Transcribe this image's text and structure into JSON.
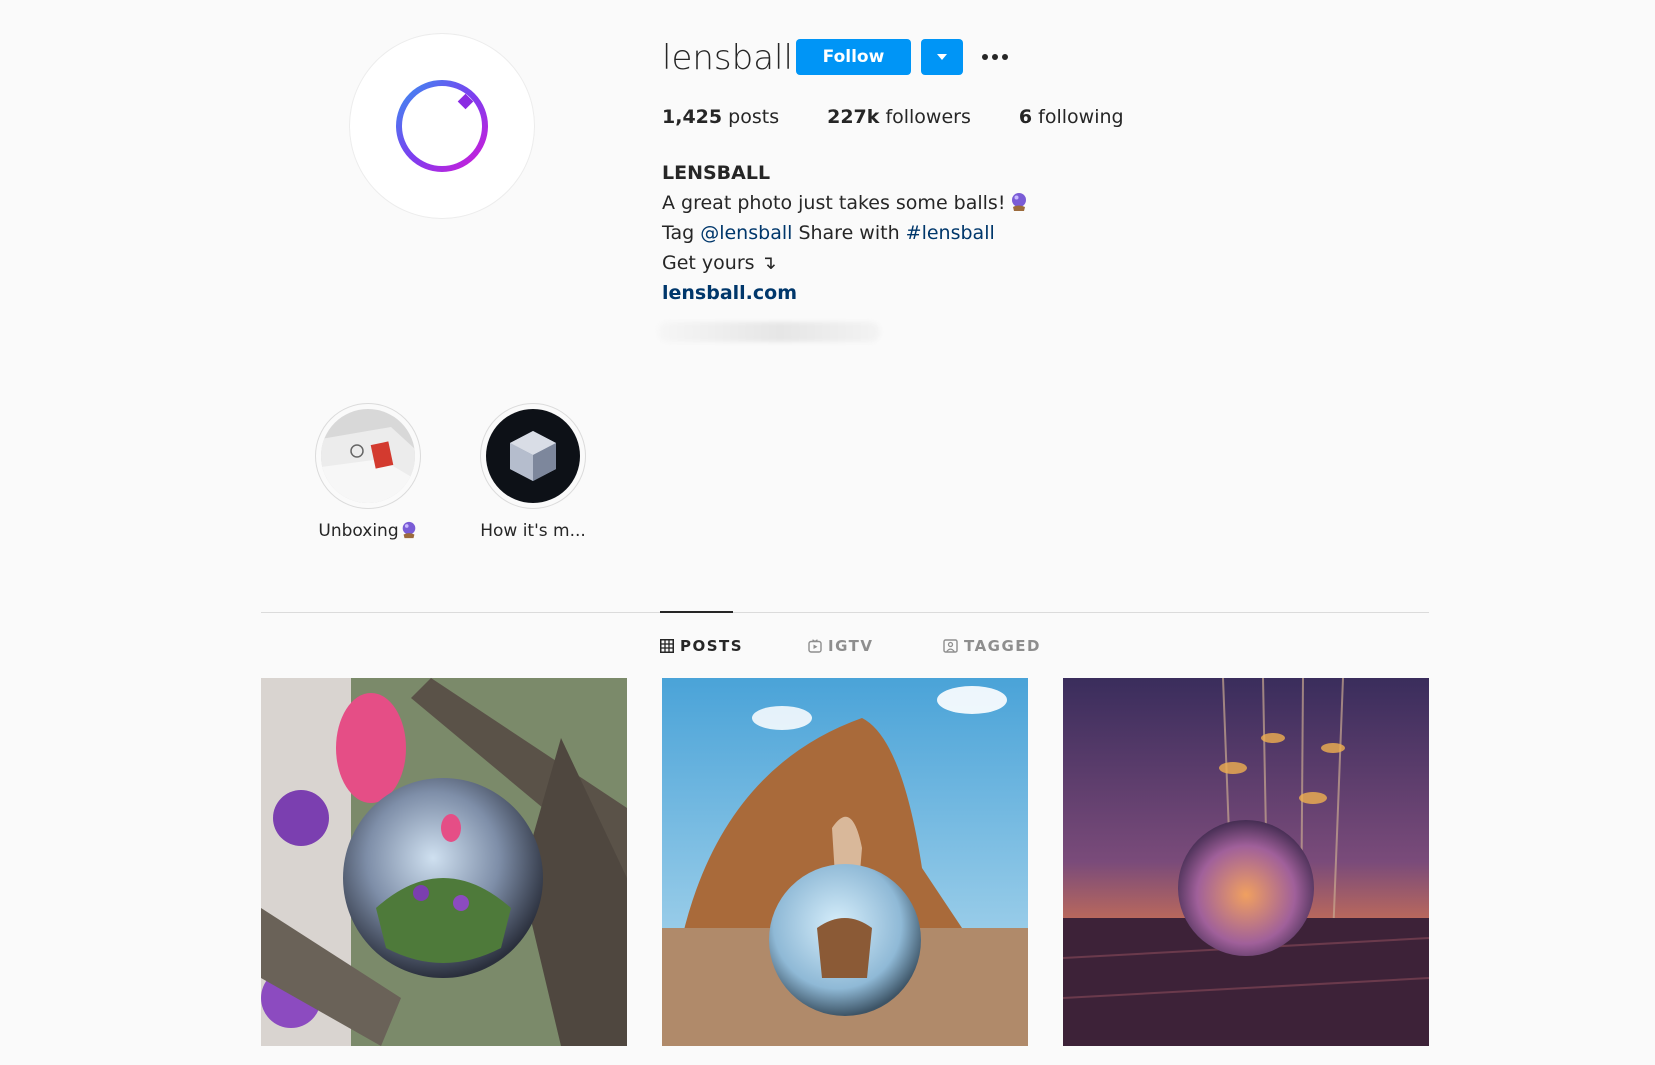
{
  "profile": {
    "username": "lensball",
    "follow_label": "Follow",
    "stats": {
      "posts_value": "1,425",
      "posts_label": "posts",
      "followers_value": "227k",
      "followers_label": "followers",
      "following_value": "6",
      "following_label": "following"
    },
    "bio": {
      "name": "LENSBALL",
      "line1": "A great photo just takes some balls!",
      "tag_prefix": "Tag",
      "tag_handle": "@lensball",
      "share_text": "Share with",
      "share_hashtag": "#lensball",
      "get_yours": "Get yours ↴",
      "website": "lensball.com"
    }
  },
  "highlights": [
    {
      "label": "Unboxing",
      "icon": "crystal-ball-emoji"
    },
    {
      "label": "How it's m..."
    }
  ],
  "tabs": [
    {
      "label": "POSTS",
      "icon": "grid-icon",
      "active": true
    },
    {
      "label": "IGTV",
      "icon": "igtv-icon",
      "active": false
    },
    {
      "label": "TAGGED",
      "icon": "tagged-icon",
      "active": false
    }
  ],
  "colors": {
    "accent": "#0095f6",
    "link": "#00376b",
    "background": "#fafafa"
  }
}
